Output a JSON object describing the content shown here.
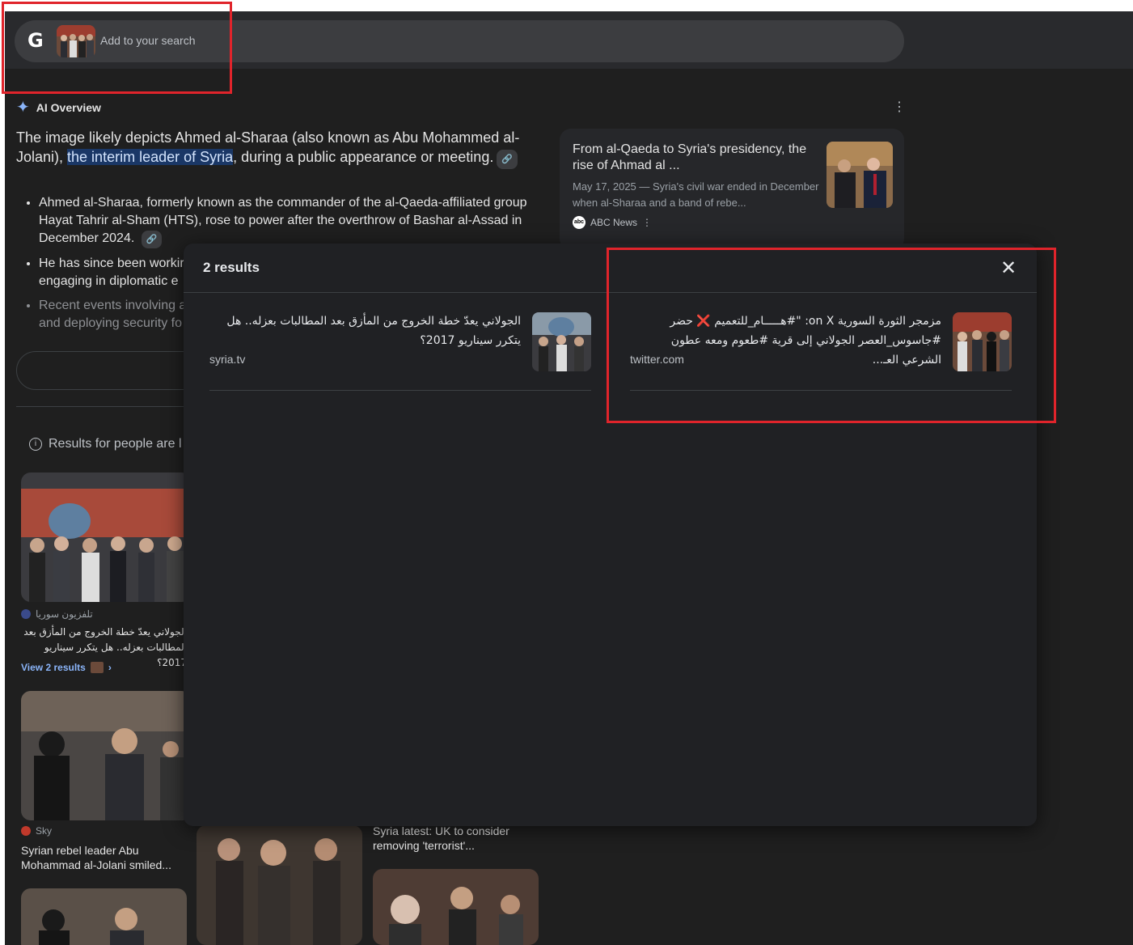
{
  "search": {
    "placeholder": "Add to your search",
    "logo": "G"
  },
  "ai_overview": {
    "label": "AI Overview",
    "para_before": "The image likely depicts Ahmed al-Sharaa (also known as Abu Mohammed al-Jolani), ",
    "para_highlight": "the interim leader of Syria",
    "para_after": ", during a public appearance or meeting.",
    "bullets": [
      "Ahmed al-Sharaa, formerly known as the commander of the al-Qaeda-affiliated group Hayat Tahrir al-Sham (HTS), rose to power after the overthrow of Bashar al-Assad in December 2024.",
      "He has since been workir",
      "engaging in diplomatic e",
      "Recent events involving a",
      "and deploying security fo"
    ]
  },
  "side_card": {
    "title": "From al-Qaeda to Syria's presidency, the rise of Ahmad al ...",
    "meta": "May 17, 2025 — Syria's civil war ended in December when al-Sharaa and a band of rebe...",
    "source": "ABC News",
    "source_logo": "abc"
  },
  "results_people": "Results for people are l",
  "left_cards": [
    {
      "source": "تلفزيون سوريا",
      "caption": "الجولاني يعدّ خطة الخروج من المأزق بعد المطالبات بعزله.. هل يتكرر سيناريو 2017؟"
    },
    {
      "source": "Sky",
      "caption": "Syrian rebel leader Abu Mohammad al-Jolani smiled..."
    }
  ],
  "view_results": "View 2 results",
  "mid_caption": "Syria latest: UK to consider removing 'terrorist'...",
  "overlay": {
    "count_label": "2 results",
    "results": [
      {
        "title": "الجولاني يعدّ خطة الخروج من المأزق بعد المطالبات بعزله.. هل يتكرر سيناريو 2017؟",
        "source": "syria.tv"
      },
      {
        "title": "مزمجر الثورة السورية on X: \"#هـــــام_للتعميم ❌ حضر #جاسوس_العصر الجولاني إلى قرية #طعوم ومعه عطون الشرعي العـ...",
        "source": "twitter.com"
      }
    ]
  },
  "colors": {
    "accent": "#8ab4f8",
    "highlight_box": "#e0242b",
    "background": "#1f1f1f"
  }
}
